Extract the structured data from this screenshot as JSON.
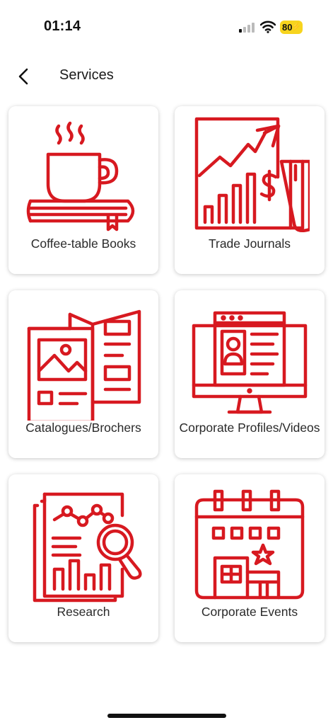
{
  "status_bar": {
    "time": "01:14",
    "battery": "80"
  },
  "header": {
    "title": "Services"
  },
  "services": [
    {
      "label": "Coffee-table Books",
      "icon": "coffee-book-icon"
    },
    {
      "label": "Trade Journals",
      "icon": "trade-journal-icon"
    },
    {
      "label": "Catalogues/Brochers",
      "icon": "brochure-icon"
    },
    {
      "label": "Corporate Profiles/Videos",
      "icon": "corporate-profile-icon"
    },
    {
      "label": "Research",
      "icon": "research-icon"
    },
    {
      "label": "Corporate Events",
      "icon": "corporate-events-icon"
    }
  ],
  "colors": {
    "accent": "#d71920",
    "card_bg": "#ffffff",
    "battery": "#f7d41e"
  }
}
